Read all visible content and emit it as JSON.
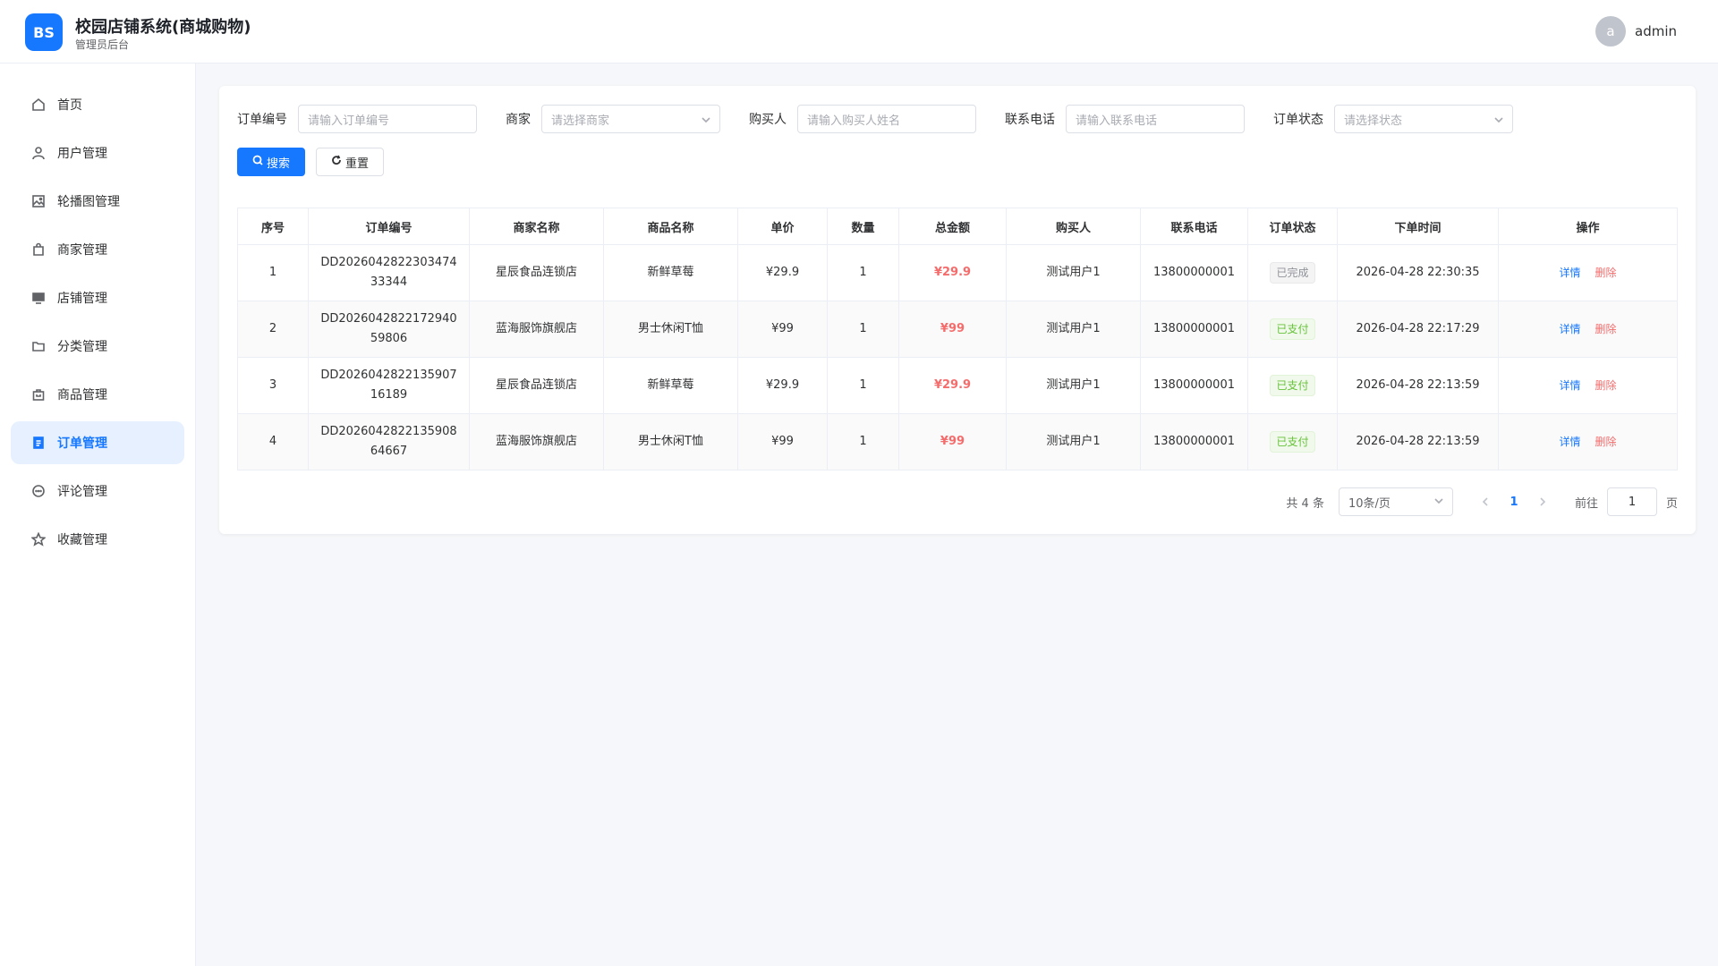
{
  "header": {
    "logo_text": "BS",
    "title": "校园店铺系统(商城购物)",
    "subtitle": "管理员后台",
    "avatar_letter": "a",
    "username": "admin"
  },
  "sidebar": {
    "items": [
      {
        "label": "首页",
        "icon": "home-icon"
      },
      {
        "label": "用户管理",
        "icon": "user-icon"
      },
      {
        "label": "轮播图管理",
        "icon": "image-icon"
      },
      {
        "label": "商家管理",
        "icon": "bag-icon"
      },
      {
        "label": "店铺管理",
        "icon": "shop-icon"
      },
      {
        "label": "分类管理",
        "icon": "folder-icon"
      },
      {
        "label": "商品管理",
        "icon": "goods-icon"
      },
      {
        "label": "订单管理",
        "icon": "document-icon"
      },
      {
        "label": "评论管理",
        "icon": "chat-icon"
      },
      {
        "label": "收藏管理",
        "icon": "star-icon"
      }
    ],
    "active": "订单管理"
  },
  "filters": {
    "order_no_label": "订单编号",
    "order_no_placeholder": "请输入订单编号",
    "merchant_label": "商家",
    "merchant_placeholder": "请选择商家",
    "buyer_label": "购买人",
    "buyer_placeholder": "请输入购买人姓名",
    "phone_label": "联系电话",
    "phone_placeholder": "请输入联系电话",
    "status_label": "订单状态",
    "status_placeholder": "请选择状态"
  },
  "buttons": {
    "search": "搜索",
    "reset": "重置"
  },
  "table": {
    "headers": [
      "序号",
      "订单编号",
      "商家名称",
      "商品名称",
      "单价",
      "数量",
      "总金额",
      "购买人",
      "联系电话",
      "订单状态",
      "下单时间",
      "操作"
    ],
    "rows": [
      {
        "index": "1",
        "order_no_1": "DD2026042822303474",
        "order_no_2": "33344",
        "merchant": "星辰食品连锁店",
        "goods": "新鲜草莓",
        "price": "¥29.9",
        "qty": "1",
        "total": "¥29.9",
        "buyer": "测试用户1",
        "phone": "13800000001",
        "status": "已完成",
        "time": "2026-04-28 22:30:35"
      },
      {
        "index": "2",
        "order_no_1": "DD2026042822172940",
        "order_no_2": "59806",
        "merchant": "蓝海服饰旗舰店",
        "goods": "男士休闲T恤",
        "price": "¥99",
        "qty": "1",
        "total": "¥99",
        "buyer": "测试用户1",
        "phone": "13800000001",
        "status": "已支付",
        "time": "2026-04-28 22:17:29"
      },
      {
        "index": "3",
        "order_no_1": "DD2026042822135907",
        "order_no_2": "16189",
        "merchant": "星辰食品连锁店",
        "goods": "新鲜草莓",
        "price": "¥29.9",
        "qty": "1",
        "total": "¥29.9",
        "buyer": "测试用户1",
        "phone": "13800000001",
        "status": "已支付",
        "time": "2026-04-28 22:13:59"
      },
      {
        "index": "4",
        "order_no_1": "DD2026042822135908",
        "order_no_2": "64667",
        "merchant": "蓝海服饰旗舰店",
        "goods": "男士休闲T恤",
        "price": "¥99",
        "qty": "1",
        "total": "¥99",
        "buyer": "测试用户1",
        "phone": "13800000001",
        "status": "已支付",
        "time": "2026-04-28 22:13:59"
      }
    ],
    "actions": {
      "detail": "详情",
      "delete": "删除"
    }
  },
  "pagination": {
    "total_text": "共 4 条",
    "page_size": "10条/页",
    "current_page": "1",
    "goto_label": "前往",
    "goto_value": "1",
    "page_suffix": "页"
  },
  "colors": {
    "primary": "#1677ff",
    "danger": "#f56c6c",
    "success": "#67c23a"
  }
}
